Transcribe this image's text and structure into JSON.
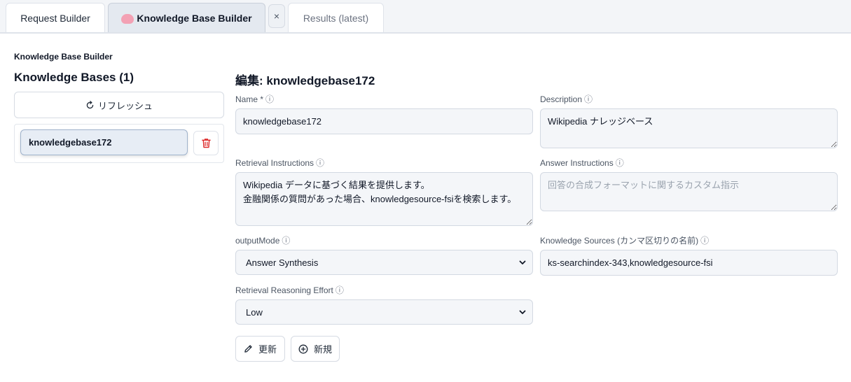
{
  "tabs": [
    {
      "label": "Request Builder"
    },
    {
      "label": "Knowledge Base Builder"
    },
    {
      "label": "Results (latest)"
    }
  ],
  "tab_close_label": "×",
  "page_header": "Knowledge Base Builder",
  "left": {
    "title": "Knowledge Bases (1)",
    "refresh_label": "リフレッシュ",
    "items": [
      {
        "name": "knowledgebase172"
      }
    ]
  },
  "form": {
    "edit_title": "編集: knowledgebase172",
    "name_label": "Name *",
    "name_value": "knowledgebase172",
    "description_label": "Description",
    "description_value": "Wikipedia ナレッジベース",
    "retrieval_instructions_label": "Retrieval Instructions",
    "retrieval_instructions_value": "Wikipedia データに基づく結果を提供します。\n金融関係の質問があった場合、knowledgesource-fsiを検索します。",
    "answer_instructions_label": "Answer Instructions",
    "answer_instructions_placeholder": "回答の合成フォーマットに関するカスタム指示",
    "output_mode_label": "outputMode",
    "output_mode_value": "Answer Synthesis",
    "knowledge_sources_label": "Knowledge Sources (カンマ区切りの名前)",
    "knowledge_sources_value": "ks-searchindex-343,knowledgesource-fsi",
    "reasoning_effort_label": "Retrieval Reasoning Effort",
    "reasoning_effort_value": "Low",
    "info_glyph": "ⓘ"
  },
  "actions": {
    "update_label": "更新",
    "new_label": "新規"
  },
  "colors": {
    "accent_selected": "#e7edf5",
    "delete_red": "#dc2626"
  }
}
